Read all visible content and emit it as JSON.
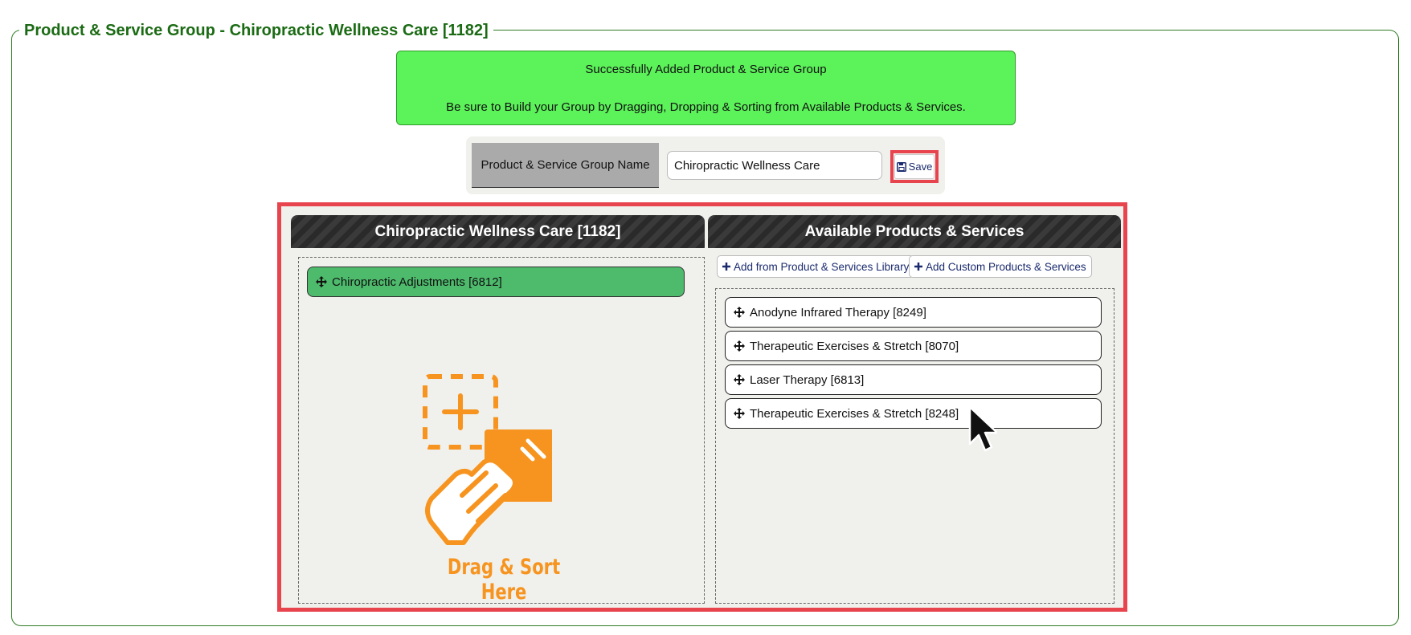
{
  "legend": "Product & Service Group - Chiropractic Wellness Care [1182]",
  "alert": {
    "line1": "Successfully Added Product & Service Group",
    "line2": "Be sure to Build your Group by Dragging, Dropping & Sorting from Available Products & Services."
  },
  "group_name": {
    "label": "Product & Service Group Name",
    "value": "Chiropractic Wellness Care",
    "save_label": "Save"
  },
  "left_column": {
    "title": "Chiropractic Wellness Care [1182]",
    "items": [
      {
        "label": "Chiropractic Adjustments [6812]"
      }
    ],
    "drop_hint": "Drag & Sort Here"
  },
  "right_column": {
    "title": "Available Products & Services",
    "buttons": {
      "library": "Add from Product & Services Library",
      "custom": "Add Custom Products & Services"
    },
    "items": [
      {
        "label": "Anodyne Infrared Therapy [8249]"
      },
      {
        "label": "Therapeutic Exercises & Stretch [8070]"
      },
      {
        "label": "Laser Therapy [6813]"
      },
      {
        "label": "Therapeutic Exercises & Stretch [8248]"
      }
    ]
  },
  "colors": {
    "legend": "#1b6b14",
    "alert_bg": "#5cf25a",
    "highlight": "#e8444e",
    "selected_item": "#4dba6c",
    "illustration": "#f6941f"
  },
  "icons": [
    "move-icon",
    "save-icon",
    "plus-icon",
    "drag-drop-illustration",
    "mouse-cursor"
  ]
}
